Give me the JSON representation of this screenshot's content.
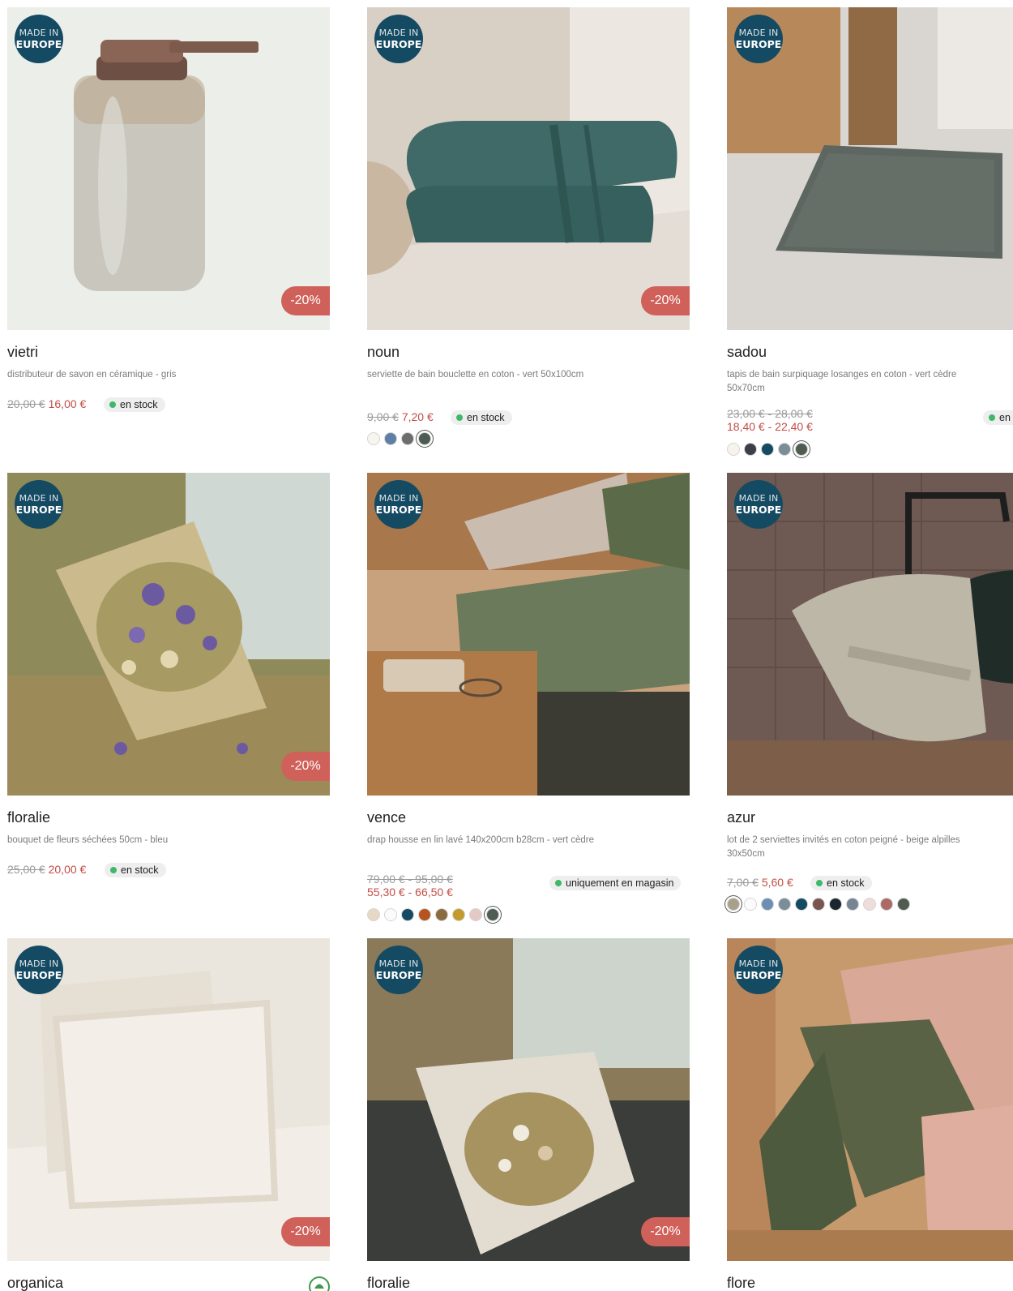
{
  "badge": {
    "line1": "MADE IN",
    "line2": "EUROPE"
  },
  "products": [
    {
      "name": "vietri",
      "desc": "distributeur de savon en céramique - gris",
      "old": "20,00 €",
      "new": "16,00 €",
      "stock": "en stock",
      "discount": "-20%",
      "swatches": []
    },
    {
      "name": "noun",
      "desc": "serviette de bain bouclette en coton - vert 50x100cm",
      "old": "9,00 €",
      "new": "7,20 €",
      "stock": "en stock",
      "discount": "-20%",
      "swatches": [
        "#f7f6ee",
        "#5e7fa6",
        "#6d6d6d",
        "#4d5c52"
      ]
    },
    {
      "name": "sadou",
      "desc": "tapis de bain surpiquage losanges en coton - vert cèdre 50x70cm",
      "old": "23,00 € - 28,00 €",
      "new": "18,40 € - 22,40 €",
      "stock": "en stock",
      "discount": "",
      "swatches": [
        "#f6f4ea",
        "#3c3f47",
        "#154a63",
        "#7b8d98",
        "#4f5c51"
      ]
    },
    {
      "name": "floralie",
      "desc": "bouquet de fleurs séchées 50cm - bleu",
      "old": "25,00 €",
      "new": "20,00 €",
      "stock": "en stock",
      "discount": "-20%",
      "swatches": []
    },
    {
      "name": "vence",
      "desc": "drap housse en lin lavé 140x200cm b28cm - vert cèdre",
      "old": "79,00 € - 95,00 €",
      "new": "55,30 € - 66,50 €",
      "stock": "uniquement en magasin",
      "discount": "",
      "swatches": [
        "#e6d8c3",
        "#fbfbfb",
        "#154a63",
        "#b5541f",
        "#8a6b40",
        "#c59a2c",
        "#e5c9c5",
        "#4f5c51"
      ]
    },
    {
      "name": "azur",
      "desc": "lot de 2 serviettes invités en coton peigné - beige alpilles 30x50cm",
      "old": "7,00 €",
      "new": "5,60 €",
      "stock": "en stock",
      "discount": "",
      "swatches": [
        "#a9a08c",
        "#fbfbfb",
        "#6e8fb3",
        "#7b8d98",
        "#154a63",
        "#7a5550",
        "#1b2530",
        "#768594",
        "#efdcdb",
        "#ab6a63",
        "#4f5c51"
      ]
    },
    {
      "name": "organica",
      "desc": "",
      "old": "",
      "new": "",
      "stock": "",
      "discount": "-20%",
      "swatches": []
    },
    {
      "name": "floralie",
      "desc": "",
      "old": "",
      "new": "",
      "stock": "",
      "discount": "-20%",
      "swatches": []
    },
    {
      "name": "flore",
      "desc": "",
      "old": "",
      "new": "",
      "stock": "",
      "discount": "",
      "swatches": []
    }
  ]
}
